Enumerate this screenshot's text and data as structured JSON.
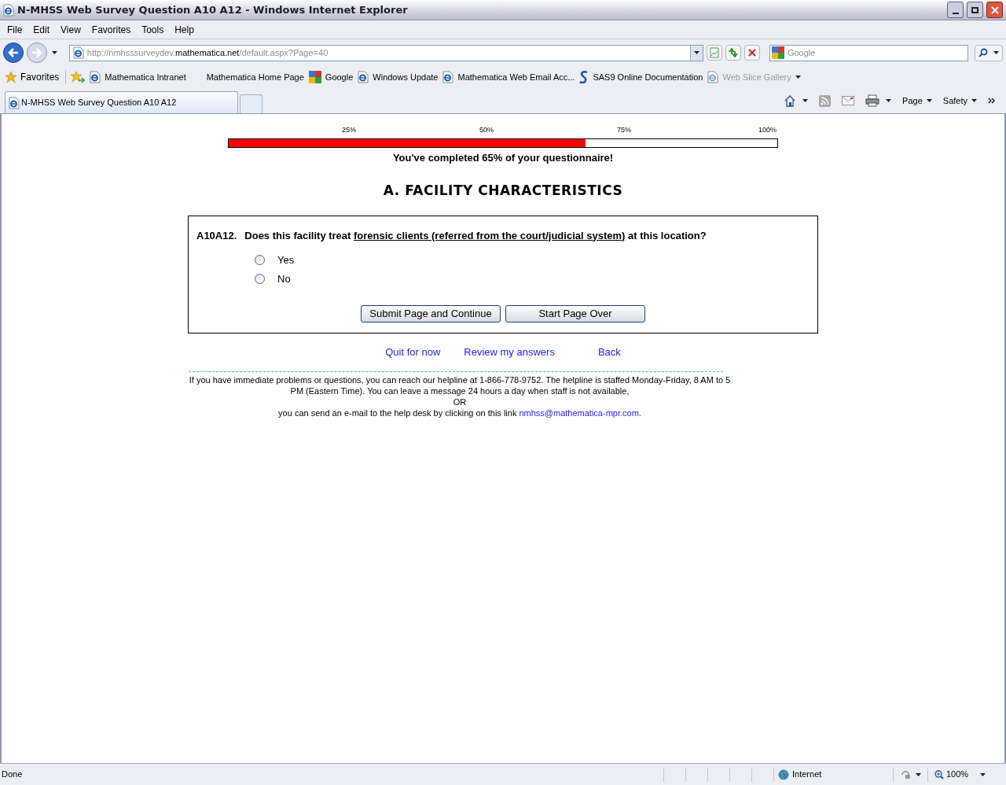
{
  "window": {
    "title": "N-MHSS Web Survey Question A10 A12 - Windows Internet Explorer"
  },
  "menu": [
    "File",
    "Edit",
    "View",
    "Favorites",
    "Tools",
    "Help"
  ],
  "address": {
    "scheme": "http://nmhsssurveydev.",
    "host": "mathematica.net",
    "path": "/default.aspx?Page=40"
  },
  "search": {
    "placeholder": "Google"
  },
  "favorites": {
    "label": "Favorites",
    "items": [
      {
        "kind": "page",
        "label": "Mathematica Intranet",
        "disabled": false
      },
      {
        "kind": "plain",
        "label": "Mathematica Home Page",
        "disabled": false
      },
      {
        "kind": "google",
        "label": "Google",
        "disabled": false
      },
      {
        "kind": "page",
        "label": "Windows Update",
        "disabled": false
      },
      {
        "kind": "page",
        "label": "Mathematica Web Email Acc...",
        "disabled": false
      },
      {
        "kind": "sas",
        "label": "SAS9 Online Documentation",
        "disabled": false
      },
      {
        "kind": "page",
        "label": "Web Slice Gallery",
        "disabled": true
      }
    ]
  },
  "tab": {
    "title": "N-MHSS Web Survey Question A10 A12"
  },
  "commands": [
    "Page",
    "Safety"
  ],
  "progress": {
    "ticks": [
      "25%",
      "50%",
      "75%",
      "100%"
    ],
    "level": 0.65,
    "message": "You've completed 65% of your questionnaire!"
  },
  "section": {
    "title": "A. FACILITY CHARACTERISTICS"
  },
  "question": {
    "number": "A10A12.",
    "text_before": "Does this facility treat ",
    "text_underlined": "forensic clients (referred from the court/judicial system)",
    "text_after": " at this location?",
    "options": [
      {
        "label": "Yes",
        "selected": false
      },
      {
        "label": "No",
        "selected": false
      }
    ],
    "buttons": [
      "Submit Page and Continue",
      "Start Page Over"
    ]
  },
  "links": [
    "Quit for now",
    "Review my answers",
    "Back"
  ],
  "help": {
    "text": "If you have immediate problems or questions, you can reach our helpline at 1-866-778-9752. The helpline is staffed Monday-Friday, 8 AM to 5 PM (Eastern Time). You can leave a message 24 hours a day when staff is not available,",
    "or": "OR",
    "email_text": "you can send an e-mail to the help desk by clicking on this link",
    "email": "nmhss@mathematica-mpr.com."
  },
  "status_bar": {
    "text": "Done",
    "zone": "Internet",
    "zoom": "100%"
  }
}
